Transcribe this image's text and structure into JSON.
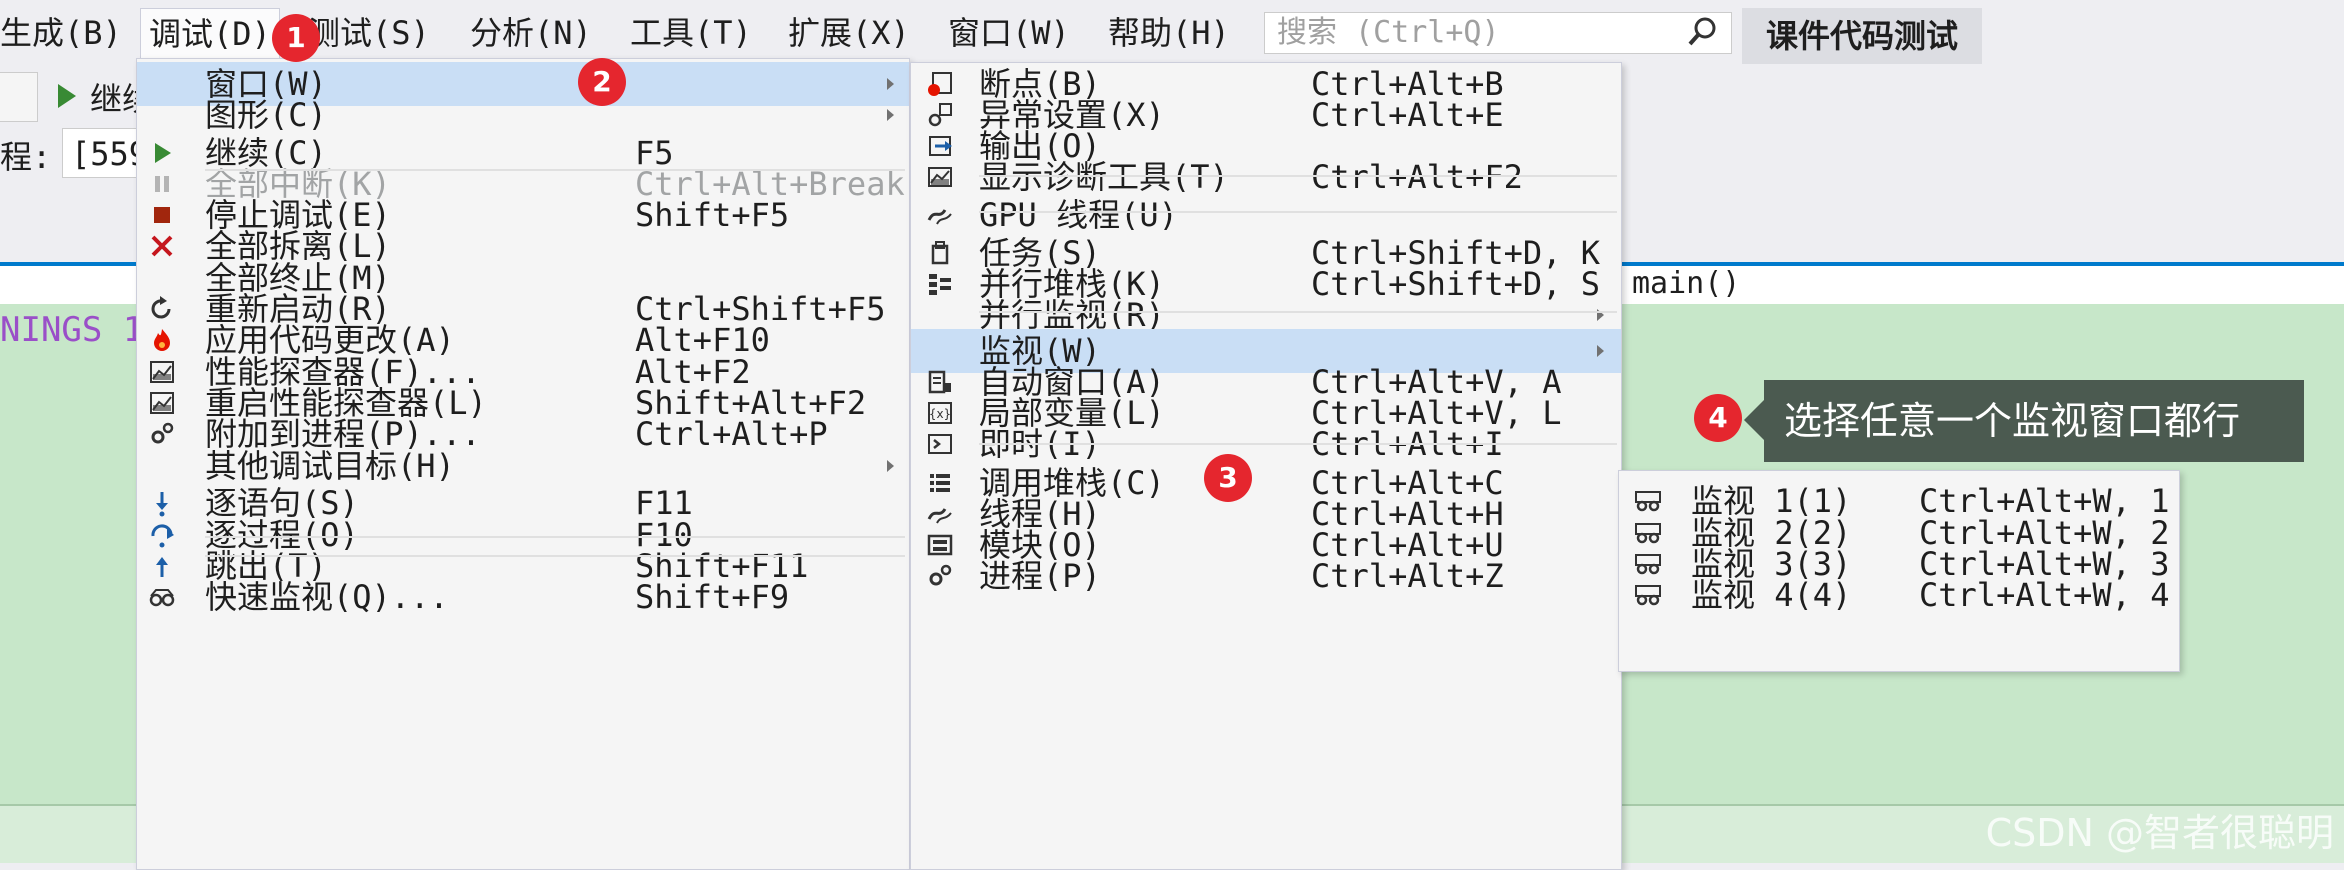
{
  "menubar": {
    "items": [
      "生成(B)",
      "调试(D)",
      "测试(S)",
      "分析(N)",
      "工具(T)",
      "扩展(X)",
      "窗口(W)",
      "帮助(H)"
    ],
    "search_placeholder": "搜索 (Ctrl+Q)",
    "project_name": "课件代码测试"
  },
  "toolbar": {
    "continue_label": "继续",
    "process_label": "程:",
    "process_value": "[559"
  },
  "editor": {
    "nav_function": "main()",
    "code_fragment": "NINGS 1"
  },
  "debug_menu": {
    "items": [
      {
        "label": "窗口(W)",
        "shortcut": "",
        "arrow": true,
        "icon": "",
        "highlight": true
      },
      {
        "label": "图形(C)",
        "shortcut": "",
        "arrow": true,
        "icon": ""
      },
      {
        "label": "继续(C)",
        "shortcut": "F5",
        "icon": "play-icon"
      },
      {
        "label": "全部中断(K)",
        "shortcut": "Ctrl+Alt+Break",
        "icon": "pause-icon",
        "disabled": true
      },
      {
        "label": "停止调试(E)",
        "shortcut": "Shift+F5",
        "icon": "stop-icon"
      },
      {
        "label": "全部拆离(L)",
        "shortcut": "",
        "icon": "close-icon"
      },
      {
        "label": "全部终止(M)",
        "shortcut": "",
        "icon": ""
      },
      {
        "label": "重新启动(R)",
        "shortcut": "Ctrl+Shift+F5",
        "icon": "restart-icon"
      },
      {
        "label": "应用代码更改(A)",
        "shortcut": "Alt+F10",
        "icon": "flame-icon"
      },
      {
        "label": "性能探查器(F)...",
        "shortcut": "Alt+F2",
        "icon": "chart-icon"
      },
      {
        "label": "重启性能探查器(L)",
        "shortcut": "Shift+Alt+F2",
        "icon": "chart-icon"
      },
      {
        "label": "附加到进程(P)...",
        "shortcut": "Ctrl+Alt+P",
        "icon": "gear-icon"
      },
      {
        "label": "其他调试目标(H)",
        "shortcut": "",
        "arrow": true,
        "icon": ""
      },
      {
        "label": "逐语句(S)",
        "shortcut": "F11",
        "icon": "step-into-icon"
      },
      {
        "label": "逐过程(O)",
        "shortcut": "F10",
        "icon": "step-over-icon"
      },
      {
        "label": "跳出(T)",
        "shortcut": "Shift+F11",
        "icon": "step-out-icon"
      },
      {
        "label": "快速监视(Q)...",
        "shortcut": "Shift+F9",
        "icon": "glasses-icon"
      }
    ]
  },
  "window_menu": {
    "items": [
      {
        "label": "断点(B)",
        "shortcut": "Ctrl+Alt+B",
        "icon": "breakpoint-icon"
      },
      {
        "label": "异常设置(X)",
        "shortcut": "Ctrl+Alt+E",
        "icon": "exception-icon"
      },
      {
        "label": "输出(O)",
        "shortcut": "",
        "icon": "output-icon"
      },
      {
        "label": "显示诊断工具(T)",
        "shortcut": "Ctrl+Alt+F2",
        "icon": "diagnostics-icon"
      },
      {
        "label": "GPU 线程(U)",
        "shortcut": "",
        "icon": "gpu-thread-icon"
      },
      {
        "label": "任务(S)",
        "shortcut": "Ctrl+Shift+D, K",
        "icon": "task-icon"
      },
      {
        "label": "并行堆栈(K)",
        "shortcut": "Ctrl+Shift+D, S",
        "icon": "parallel-stacks-icon"
      },
      {
        "label": "并行监视(R)",
        "shortcut": "",
        "arrow": true,
        "icon": ""
      },
      {
        "label": "监视(W)",
        "shortcut": "",
        "arrow": true,
        "icon": "",
        "highlight": true
      },
      {
        "label": "自动窗口(A)",
        "shortcut": "Ctrl+Alt+V, A",
        "icon": "autos-icon"
      },
      {
        "label": "局部变量(L)",
        "shortcut": "Ctrl+Alt+V, L",
        "icon": "locals-icon"
      },
      {
        "label": "即时(I)",
        "shortcut": "Ctrl+Alt+I",
        "icon": "immediate-icon"
      },
      {
        "label": "调用堆栈(C)",
        "shortcut": "Ctrl+Alt+C",
        "icon": "call-stack-icon"
      },
      {
        "label": "线程(H)",
        "shortcut": "Ctrl+Alt+H",
        "icon": "threads-icon"
      },
      {
        "label": "模块(O)",
        "shortcut": "Ctrl+Alt+U",
        "icon": "modules-icon"
      },
      {
        "label": "进程(P)",
        "shortcut": "Ctrl+Alt+Z",
        "icon": "process-icon"
      }
    ]
  },
  "watch_menu": {
    "items": [
      {
        "label": "监视 1(1)",
        "shortcut": "Ctrl+Alt+W, 1",
        "icon": "watch-icon"
      },
      {
        "label": "监视 2(2)",
        "shortcut": "Ctrl+Alt+W, 2",
        "icon": "watch-icon"
      },
      {
        "label": "监视 3(3)",
        "shortcut": "Ctrl+Alt+W, 3",
        "icon": "watch-icon"
      },
      {
        "label": "监视 4(4)",
        "shortcut": "Ctrl+Alt+W, 4",
        "icon": "watch-icon"
      }
    ]
  },
  "annotations": {
    "badge1": "1",
    "badge2": "2",
    "badge3": "3",
    "badge4": "4",
    "callout": "选择任意一个监视窗口都行"
  },
  "watermark": "CSDN @智者很聪明",
  "colors": {
    "highlight": "#c9def5",
    "badge": "#e5262e",
    "editor_bg": "#c7e7c9",
    "callout_bg": "#4b5a50"
  }
}
